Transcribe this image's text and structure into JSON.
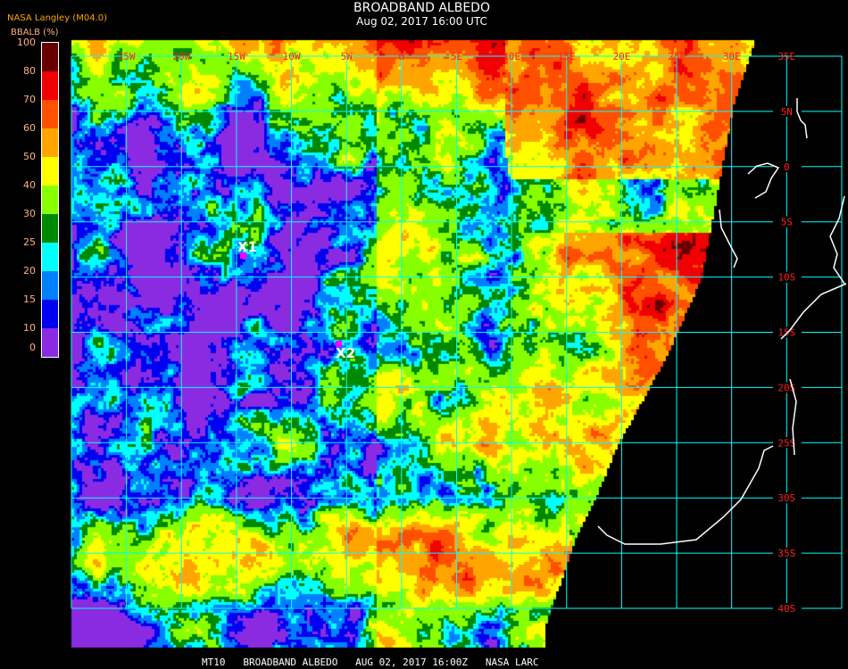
{
  "header": {
    "title": "BROADBAND ALBEDO",
    "subtitle": "Aug 02, 2017 16:00 UTC",
    "source": "NASA Langley (M04.0)",
    "units": "BBALB (%)"
  },
  "legend": {
    "ticks": [
      "100",
      "80",
      "70",
      "60",
      "50",
      "40",
      "30",
      "25",
      "20",
      "15",
      "10",
      "0"
    ],
    "bins": [
      {
        "range": "80-100",
        "color": "#660000"
      },
      {
        "range": "70-80",
        "color": "#f00000"
      },
      {
        "range": "60-70",
        "color": "#ff5000"
      },
      {
        "range": "50-60",
        "color": "#ffa500"
      },
      {
        "range": "40-50",
        "color": "#ffff00"
      },
      {
        "range": "30-40",
        "color": "#88ff00"
      },
      {
        "range": "25-30",
        "color": "#008800"
      },
      {
        "range": "20-25",
        "color": "#00ffff"
      },
      {
        "range": "15-20",
        "color": "#0080ff"
      },
      {
        "range": "10-15",
        "color": "#0000f0"
      },
      {
        "range": "0-10",
        "color": "#8a2be2"
      }
    ]
  },
  "map": {
    "grid_color": "#00ffff",
    "label_color": "#ff2020",
    "coast_color": "#ffffff",
    "longitude_labels": [
      "25W",
      "20W",
      "15W",
      "10W",
      "5W",
      "0",
      "5E",
      "10E",
      "15E",
      "20E",
      "25E",
      "30E",
      "35E"
    ],
    "latitude_labels": [
      "5N",
      "0",
      "5S",
      "10S",
      "15S",
      "20S",
      "25S",
      "30S",
      "35S",
      "40S"
    ],
    "markers": [
      {
        "label": "X1",
        "color": "#ff00ff"
      },
      {
        "label": "X2",
        "color": "#ff00ff"
      }
    ]
  },
  "footer": "MT10   BROADBAND ALBEDO   AUG 02, 2017 16:00Z   NASA LARC"
}
